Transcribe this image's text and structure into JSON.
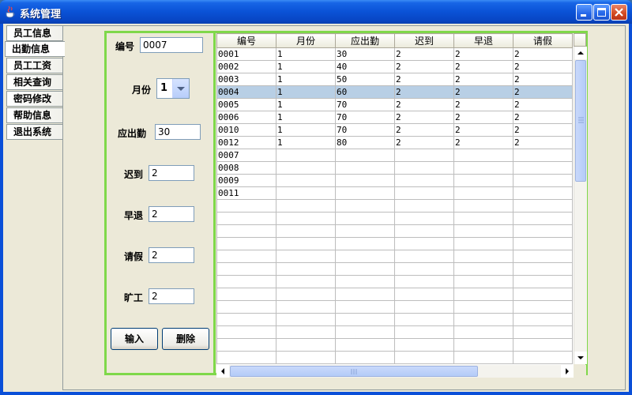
{
  "window": {
    "title": "系统管理"
  },
  "tabs": [
    "员工信息",
    "出勤信息",
    "员工工资",
    "相关查询",
    "密码修改",
    "帮助信息",
    "退出系统"
  ],
  "active_tab": "出勤信息",
  "form": {
    "id_label": "编号",
    "id_value": "0007",
    "month_label": "月份",
    "month_value": "1",
    "due_label": "应出勤",
    "due_value": "30",
    "late_label": "迟到",
    "late_value": "2",
    "early_label": "早退",
    "early_value": "2",
    "leave_label": "请假",
    "leave_value": "2",
    "absent_label": "旷工",
    "absent_value": "2",
    "input_button": "输入",
    "delete_button": "删除"
  },
  "table": {
    "columns": [
      "编号",
      "月份",
      "应出勤",
      "迟到",
      "早退",
      "请假"
    ],
    "selected_row": 3,
    "total_rows": 25,
    "rows": [
      [
        "0001",
        "1",
        "30",
        "2",
        "2",
        "2"
      ],
      [
        "0002",
        "1",
        "40",
        "2",
        "2",
        "2"
      ],
      [
        "0003",
        "1",
        "50",
        "2",
        "2",
        "2"
      ],
      [
        "0004",
        "1",
        "60",
        "2",
        "2",
        "2"
      ],
      [
        "0005",
        "1",
        "70",
        "2",
        "2",
        "2"
      ],
      [
        "0006",
        "1",
        "70",
        "2",
        "2",
        "2"
      ],
      [
        "0010",
        "1",
        "70",
        "2",
        "2",
        "2"
      ],
      [
        "0012",
        "1",
        "80",
        "2",
        "2",
        "2"
      ],
      [
        "0007",
        "",
        "",
        "",
        "",
        ""
      ],
      [
        "0008",
        "",
        "",
        "",
        "",
        ""
      ],
      [
        "0009",
        "",
        "",
        "",
        "",
        ""
      ],
      [
        "0011",
        "",
        "",
        "",
        "",
        ""
      ]
    ]
  },
  "icons": {
    "app": "java-cup-icon",
    "minimize": "minimize-icon",
    "maximize": "maximize-icon",
    "close": "close-icon"
  },
  "colors": {
    "panel_border": "#7fd84a",
    "selection": "#b8cfe5",
    "titlebar": "#0a52d6"
  }
}
